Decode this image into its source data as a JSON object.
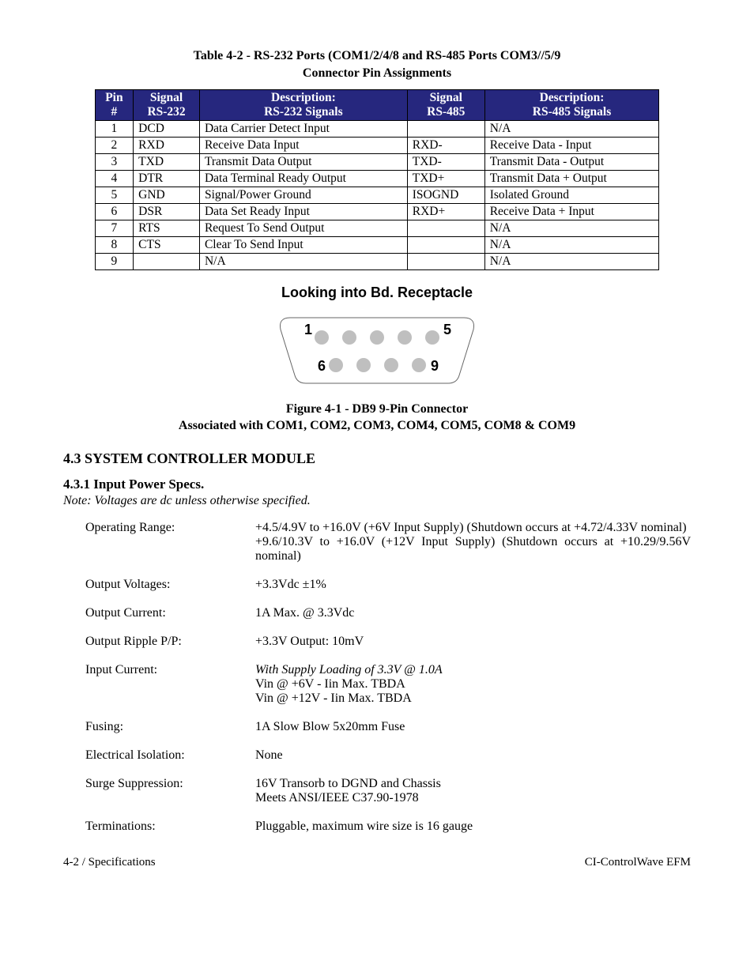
{
  "table": {
    "title_l1": "Table 4-2 - RS-232 Ports (COM1/2/4/8 and RS-485 Ports COM3//5/9",
    "title_l2": "Connector Pin Assignments",
    "headers": {
      "pin_l1": "Pin",
      "pin_l2": "#",
      "sig232_l1": "Signal",
      "sig232_l2": "RS-232",
      "desc232_l1": "Description:",
      "desc232_l2": "RS-232 Signals",
      "sig485_l1": "Signal",
      "sig485_l2": "RS-485",
      "desc485_l1": "Description:",
      "desc485_l2": "RS-485 Signals"
    },
    "rows": [
      {
        "pin": "1",
        "s232": "DCD",
        "d232": "Data Carrier Detect Input",
        "s485": "",
        "d485": "N/A"
      },
      {
        "pin": "2",
        "s232": "RXD",
        "d232": "Receive Data Input",
        "s485": "RXD-",
        "d485": "Receive Data - Input"
      },
      {
        "pin": "3",
        "s232": "TXD",
        "d232": "Transmit Data Output",
        "s485": "TXD-",
        "d485": "Transmit Data - Output"
      },
      {
        "pin": "4",
        "s232": "DTR",
        "d232": "Data Terminal Ready Output",
        "s485": "TXD+",
        "d485": "Transmit Data + Output"
      },
      {
        "pin": "5",
        "s232": "GND",
        "d232": "Signal/Power Ground",
        "s485": "ISOGND",
        "d485": "Isolated Ground"
      },
      {
        "pin": "6",
        "s232": "DSR",
        "d232": "Data Set Ready Input",
        "s485": "RXD+",
        "d485": "Receive Data + Input"
      },
      {
        "pin": "7",
        "s232": "RTS",
        "d232": "Request To Send Output",
        "s485": "",
        "d485": "N/A"
      },
      {
        "pin": "8",
        "s232": "CTS",
        "d232": "Clear To Send Input",
        "s485": "",
        "d485": "N/A"
      },
      {
        "pin": "9",
        "s232": "",
        "d232": "N/A",
        "s485": "",
        "d485": "N/A"
      }
    ]
  },
  "figure": {
    "top_title": "Looking into Bd. Receptacle",
    "pins": {
      "tl": "1",
      "tr": "5",
      "bl": "6",
      "br": "9"
    },
    "caption_l1": "Figure 4-1 - DB9 9-Pin Connector",
    "caption_l2": "Associated with COM1, COM2, COM3, COM4, COM5, COM8 & COM9"
  },
  "section": {
    "h2": "4.3  SYSTEM CONTROLLER MODULE",
    "h3": "4.3.1  Input Power Specs.",
    "note": "Note: Voltages are dc unless otherwise specified."
  },
  "specs": {
    "op_range_label": "Operating Range:",
    "op_range_l1": "+4.5/4.9V to +16.0V (+6V Input Supply) (Shutdown occurs at +4.72/4.33V nominal)",
    "op_range_l2": "+9.6/10.3V to +16.0V (+12V Input Supply) (Shutdown occurs at +10.29/9.56V nominal)",
    "out_v_label": "Output Voltages:",
    "out_v_val": "+3.3Vdc ±1%",
    "out_c_label": "Output Current:",
    "out_c_val": "1A Max. @ 3.3Vdc",
    "out_r_label": "Output Ripple P/P:",
    "out_r_val": "+3.3V Output: 10mV",
    "in_c_label": "Input Current:",
    "in_c_l1": "With Supply Loading of 3.3V @ 1.0A",
    "in_c_l2": "Vin @ +6V - Iin Max. TBDA",
    "in_c_l3": "Vin @ +12V - Iin Max. TBDA",
    "fuse_label": "Fusing:",
    "fuse_val": "1A Slow Blow 5x20mm Fuse",
    "iso_label": "Electrical Isolation:",
    "iso_val": "None",
    "surge_label": "Surge Suppression:",
    "surge_l1": "16V Transorb to DGND and Chassis",
    "surge_l2": "Meets ANSI/IEEE C37.90-1978",
    "term_label": "Terminations:",
    "term_val": "Pluggable, maximum wire size is 16 gauge"
  },
  "footer": {
    "left": "4-2 / Specifications",
    "right": "CI-ControlWave EFM"
  }
}
